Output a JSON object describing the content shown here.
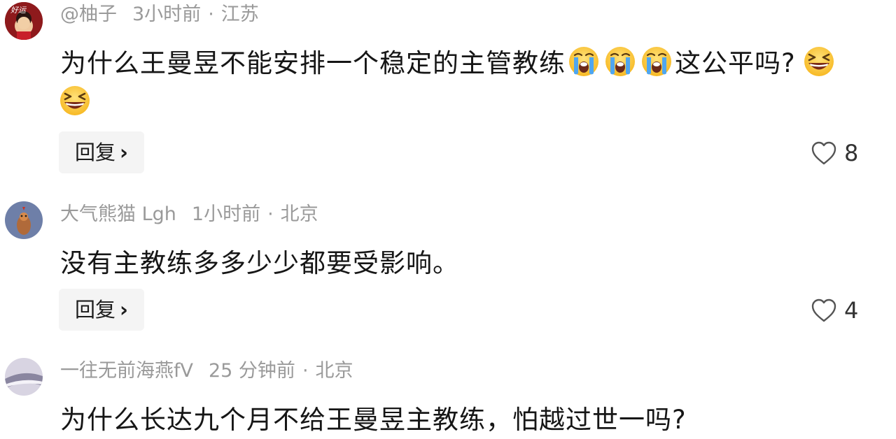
{
  "comments": [
    {
      "username": "@柚子",
      "time": "3小时前",
      "separator": "·",
      "location": "江苏",
      "avatar_text": "好运",
      "text_line1": "为什么王曼昱不能安排一个稳定的主管教练",
      "text_line1_tail": "这公平吗?",
      "reply_label": "回复",
      "like_count": "8",
      "emoji_cry": "loudly-crying-face",
      "emoji_laugh": "grinning-squinting-face"
    },
    {
      "username": "大气熊猫 Lgh",
      "time": "1小时前",
      "separator": "·",
      "location": "北京",
      "text": "没有主教练多多少少都要受影响。",
      "reply_label": "回复",
      "like_count": "4"
    },
    {
      "username": "一往无前海燕fV",
      "time": "25 分钟前",
      "separator": "·",
      "location": "北京",
      "text": "为什么长达九个月不给王曼昱主教练，怕越过世一吗?"
    }
  ],
  "colors": {
    "meta_gray": "#9a9a9a",
    "text_dark": "#161616",
    "reply_bg": "#f4f4f4"
  }
}
